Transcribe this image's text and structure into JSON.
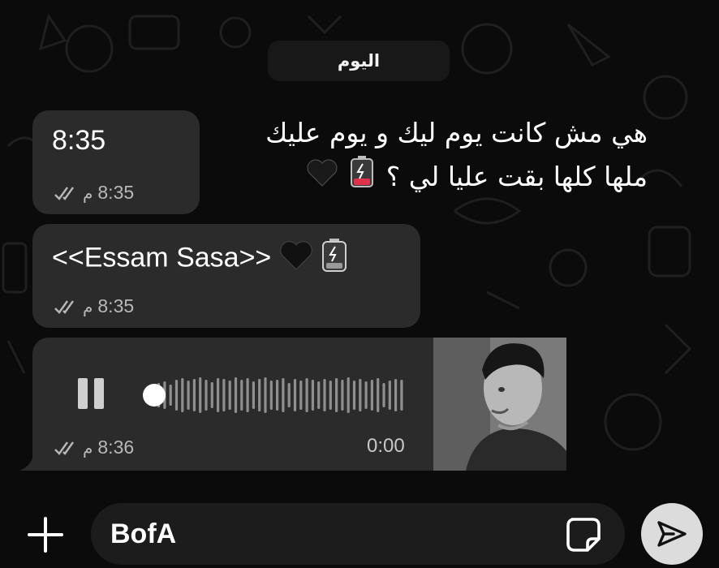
{
  "chat": {
    "date_separator": "اليوم",
    "caption_line1": "هي مش كانت يوم ليك و يوم عليك",
    "caption_line2": "ملها كلها بقت عليا لي ؟",
    "caption_emojis": [
      "heart-icon",
      "battery-empty-icon"
    ]
  },
  "messages": [
    {
      "type": "text",
      "text": "8:35",
      "time": "8:35",
      "ampm": "م",
      "status": "read-double-check-icon"
    },
    {
      "type": "text",
      "text": "<<Essam Sasa>>",
      "emojis": [
        "black-heart-icon",
        "battery-icon"
      ],
      "time": "8:35",
      "ampm": "م",
      "status": "read-double-check-icon"
    },
    {
      "type": "voice",
      "duration": "0:00",
      "time": "8:36",
      "ampm": "م",
      "status": "read-double-check-icon",
      "progress": 0,
      "playing": true
    }
  ],
  "composer": {
    "value": "BofA",
    "attach_icon": "plus-icon",
    "sticker_icon": "sticker-icon",
    "send_icon": "send-icon"
  },
  "colors": {
    "background": "#0b0b0b",
    "bubble": "#2b2b2b",
    "meta_text": "#b8b8b8",
    "send_button": "#dcdcdc"
  }
}
